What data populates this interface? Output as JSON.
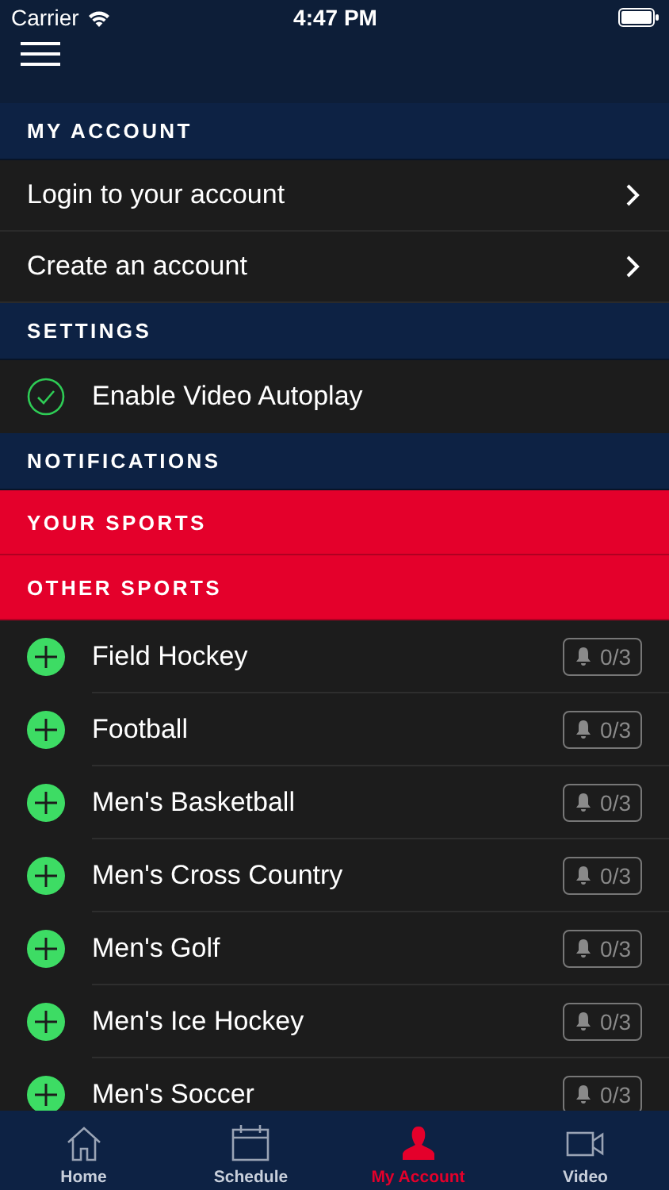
{
  "status_bar": {
    "carrier": "Carrier",
    "time": "4:47 PM"
  },
  "menu": [
    {
      "kind": "section",
      "label": "MY ACCOUNT",
      "highlighted": false
    },
    {
      "kind": "link",
      "label": "Login to your account"
    },
    {
      "kind": "link",
      "label": "Create an account"
    },
    {
      "kind": "section",
      "label": "SETTINGS",
      "highlighted": false
    },
    {
      "kind": "toggle",
      "label": "Enable Video Autoplay",
      "checked": true
    },
    {
      "kind": "section",
      "label": "NOTIFICATIONS",
      "highlighted": false
    },
    {
      "kind": "section",
      "label": "YOUR SPORTS",
      "highlighted": true
    },
    {
      "kind": "section",
      "label": "OTHER SPORTS",
      "highlighted": true
    },
    {
      "kind": "sport",
      "label": "Field Hockey",
      "count": "0/3"
    },
    {
      "kind": "sport",
      "label": "Football",
      "count": "0/3"
    },
    {
      "kind": "sport",
      "label": "Men's Basketball",
      "count": "0/3"
    },
    {
      "kind": "sport",
      "label": "Men's Cross Country",
      "count": "0/3"
    },
    {
      "kind": "sport",
      "label": "Men's Golf",
      "count": "0/3"
    },
    {
      "kind": "sport",
      "label": "Men's Ice Hockey",
      "count": "0/3"
    },
    {
      "kind": "sport",
      "label": "Men's Soccer",
      "count": "0/3"
    }
  ],
  "tab_bar": [
    {
      "kind": "home",
      "label": "Home",
      "selected": false
    },
    {
      "kind": "schedule",
      "label": "Schedule",
      "selected": false
    },
    {
      "kind": "account",
      "label": "My Account",
      "selected": true
    },
    {
      "kind": "video",
      "label": "Video",
      "selected": false
    }
  ]
}
